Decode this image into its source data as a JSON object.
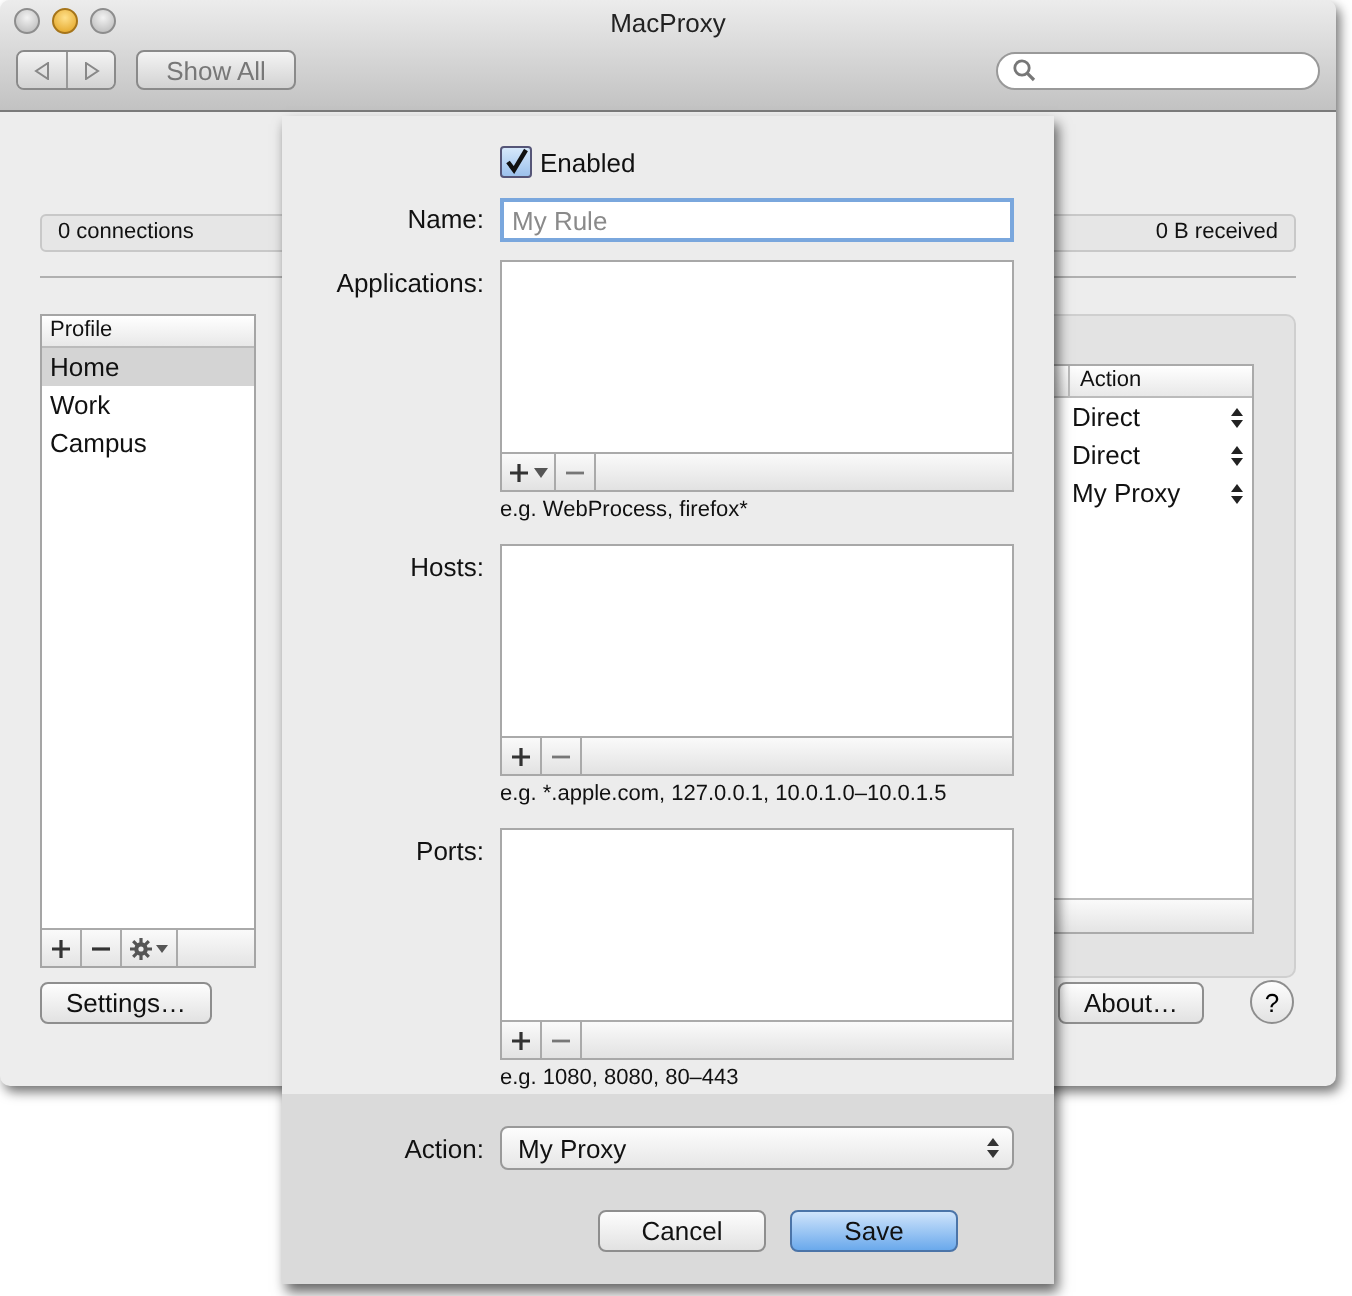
{
  "window": {
    "title": "MacProxy"
  },
  "toolbar": {
    "show_all": "Show All"
  },
  "stats": {
    "connections": "0 connections",
    "received": "0 B received"
  },
  "profiles": {
    "header": "Profile",
    "items": [
      {
        "label": "Home",
        "selected": true
      },
      {
        "label": "Work",
        "selected": false
      },
      {
        "label": "Campus",
        "selected": false
      }
    ]
  },
  "rules_table": {
    "column": "Action",
    "rows": [
      {
        "action": "Direct"
      },
      {
        "action": "Direct"
      },
      {
        "action": "My Proxy"
      }
    ]
  },
  "buttons": {
    "settings": "Settings…",
    "about": "About…",
    "help": "?"
  },
  "sheet": {
    "enabled": {
      "label": "Enabled",
      "checked": true
    },
    "name": {
      "label": "Name:",
      "placeholder": "My Rule"
    },
    "lists": [
      {
        "label": "Applications:",
        "hint": "e.g. WebProcess, firefox*",
        "add_menu": true
      },
      {
        "label": "Hosts:",
        "hint": "e.g. *.apple.com, 127.0.0.1, 10.0.1.0–10.0.1.5",
        "add_menu": false
      },
      {
        "label": "Ports:",
        "hint": "e.g. 1080, 8080, 80–443",
        "add_menu": false
      }
    ],
    "action": {
      "label": "Action:",
      "value": "My Proxy"
    },
    "buttons": [
      {
        "label": "Cancel",
        "default": false
      },
      {
        "label": "Save",
        "default": true
      }
    ]
  }
}
